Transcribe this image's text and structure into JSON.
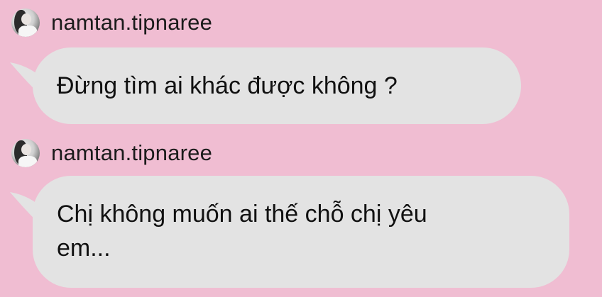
{
  "messages": [
    {
      "sender": "namtan.tipnaree",
      "text": "Đừng tìm ai khác được không ?"
    },
    {
      "sender": "namtan.tipnaree",
      "text": "Chị không muốn ai thế chỗ chị yêu\nem..."
    }
  ],
  "colors": {
    "background": "#f0bdd2",
    "bubble": "#e3e3e3",
    "text": "#111111"
  }
}
